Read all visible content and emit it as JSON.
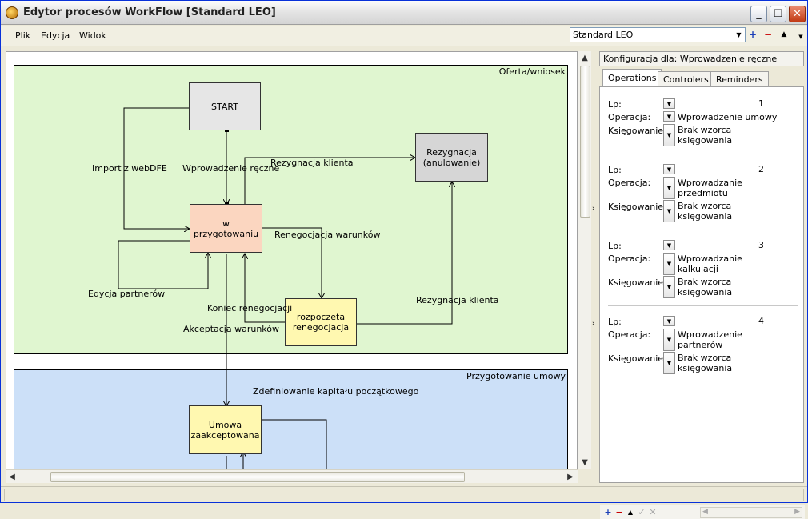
{
  "window": {
    "title": "Edytor procesów WorkFlow [Standard LEO]"
  },
  "menu": {
    "items": [
      "Plik",
      "Edycja",
      "Widok"
    ]
  },
  "toolbar": {
    "workflow_select": "Standard LEO"
  },
  "diagram": {
    "lanes": [
      {
        "title": "Oferta/wniosek"
      },
      {
        "title": "Przygotowanie umowy"
      }
    ],
    "nodes": {
      "start": "START",
      "rezygnacja": "Rezygnacja (anulowanie)",
      "przygotowanie": "w przygotowaniu",
      "renegocjacja": "rozpoczeta renegocjacja",
      "umowa": "Umowa zaakceptowana"
    },
    "edge_labels": {
      "import": "Import z webDFE",
      "wprowadzenie": "Wprowadzenie ręczne",
      "rezygnacja_klienta_top": "Rezygnacja klienta",
      "renegocjacja_warunkow": "Renegocjacja warunków",
      "edycja_partnerow": "Edycja partnerów",
      "koniec_renegocjacji": "Koniec renegocjacji",
      "rezygnacja_klienta_right": "Rezygnacja klienta",
      "akceptacja": "Akceptacja warunków",
      "zdefiniowanie": "Zdefiniowanie kapitału początkowego"
    },
    "colors": {
      "lane1": "#e0f6d0",
      "lane2": "#cce0f8",
      "start": "#e6e6e6",
      "rezygnacja": "#d6d6d6",
      "przygotowanie": "#fbd6c0",
      "renegocjacja": "#fff8b0",
      "umowa": "#fff8b0"
    }
  },
  "config_panel": {
    "header": "Konfiguracja dla: Wprowadzenie ręczne",
    "tabs": [
      "Operations",
      "Controlers",
      "Reminders"
    ],
    "active_tab": "Operations",
    "labels": {
      "lp": "Lp:",
      "operacja": "Operacja:",
      "ksiegowanie": "Księgowanie:"
    },
    "operations": [
      {
        "lp": "1",
        "operacja": "Wprowadzenie umowy",
        "ksiegowanie": "Brak wzorca księgowania"
      },
      {
        "lp": "2",
        "operacja": "Wprowadzanie przedmiotu",
        "ksiegowanie": "Brak wzorca księgowania"
      },
      {
        "lp": "3",
        "operacja": "Wprowadzanie kalkulacji",
        "ksiegowanie": "Brak wzorca księgowania"
      },
      {
        "lp": "4",
        "operacja": "Wprowadzenie partnerów",
        "ksiegowanie": "Brak wzorca księgowania"
      }
    ]
  }
}
